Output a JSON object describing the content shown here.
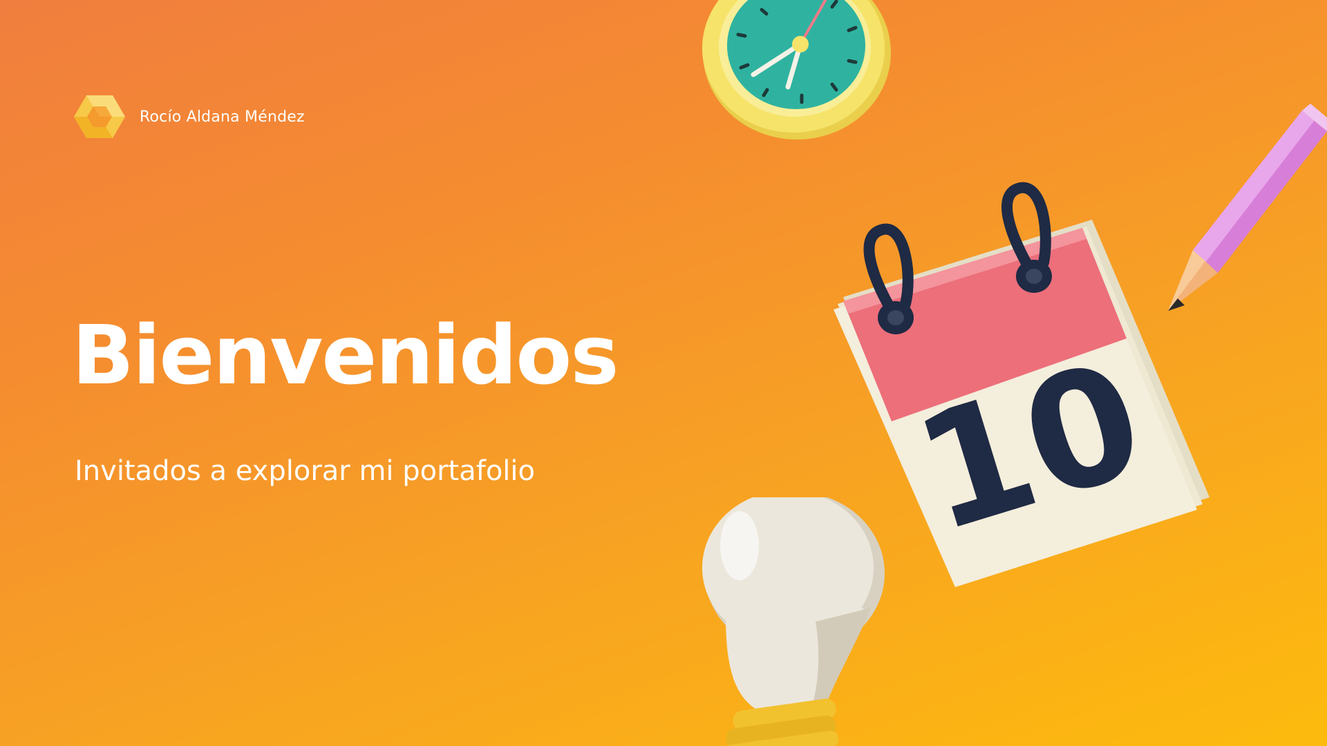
{
  "brand": {
    "name": "Rocío Aldana Méndez",
    "logo_icon": "hexagon-logo-icon"
  },
  "hero": {
    "title": "Bienvenidos",
    "subtitle": "Invitados a explorar mi portafolio"
  },
  "illustrations": {
    "clock": "clock-icon",
    "pencil": "pencil-icon",
    "calendar": "calendar-icon",
    "calendar_day": "10",
    "lightbulb": "lightbulb-icon"
  },
  "colors": {
    "background_start": "#F07E3E",
    "background_end": "#FDBB0D",
    "text": "#FFFFFF",
    "logo_yellow": "#F7C948",
    "clock_face": "#2FB3A0",
    "clock_rim": "#F6E36A",
    "calendar_header": "#EC6F7A",
    "calendar_page": "#F4EEDC",
    "calendar_digits": "#1F2A44",
    "pencil_body": "#D77FD8",
    "bulb_glass": "#ECE7DC",
    "bulb_base": "#F2C12E"
  }
}
